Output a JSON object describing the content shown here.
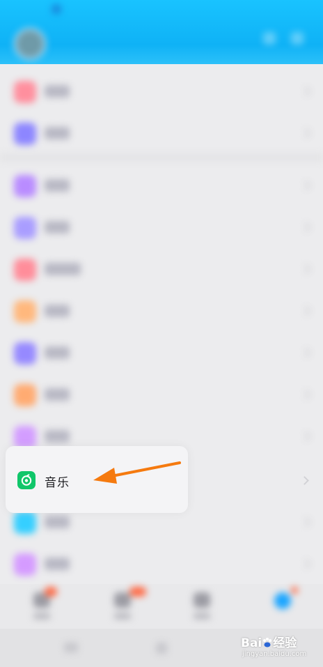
{
  "music_item": {
    "label": "音乐",
    "icon": "music-disc-icon",
    "icon_color": "#10c66a"
  },
  "annotation": {
    "arrow_color": "#f57a0f",
    "points_to": "music_item"
  },
  "blurred_list_icon_colors": [
    "#ff8f9e",
    "#8d86ff",
    "#b98cff",
    "#a99dff",
    "#ff8d9a",
    "#ffb87d",
    "#9689ff",
    "#ffab72",
    "#d39dff",
    "#35cfff",
    "#d59bff"
  ],
  "header": {
    "background": "#12bbfa"
  },
  "tabbar": {
    "active_color": "#1aa5ff",
    "badge_color": "#ff6a45"
  },
  "watermark": {
    "brand": "Bai",
    "brand_suffix": "经验",
    "subtitle": "jingyan.baidu.com"
  }
}
